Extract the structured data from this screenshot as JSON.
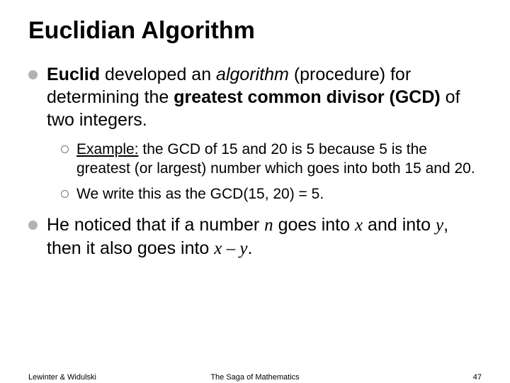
{
  "title": "Euclidian Algorithm",
  "bullets": {
    "b1_prefix": "Euclid",
    "b1_mid1": " developed an ",
    "b1_algorithm": "algorithm",
    "b1_mid2": " (procedure) for determining the ",
    "b1_gcd": "greatest common divisor (GCD)",
    "b1_tail": " of two integers.",
    "sub": {
      "s1_label": "Example:",
      "s1_text": " the GCD of 15 and 20 is 5 because 5 is the greatest (or largest) number which goes into both 15 and 20.",
      "s2_prefix": "We",
      "s2_text": " write this as the GCD(15, 20) = 5."
    },
    "b2_prefix": "He noticed that if a number ",
    "b2_n": "n",
    "b2_mid1": " goes into ",
    "b2_x": "x",
    "b2_mid2": " and into ",
    "b2_y": "y",
    "b2_mid3": ", then it also goes into ",
    "b2_xmy": "x – y",
    "b2_tail": "."
  },
  "footer": {
    "left": "Lewinter & Widulski",
    "center": "The Saga of Mathematics",
    "right": "47"
  }
}
